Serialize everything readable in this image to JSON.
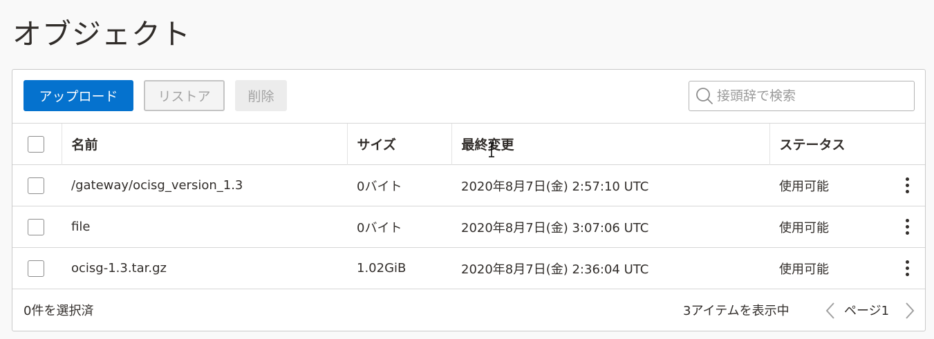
{
  "page": {
    "title": "オブジェクト"
  },
  "toolbar": {
    "upload_label": "アップロード",
    "restore_label": "リストア",
    "delete_label": "削除"
  },
  "search": {
    "placeholder": "接頭辞で検索",
    "value": "",
    "icon": "search-icon"
  },
  "table": {
    "headers": {
      "name": "名前",
      "size": "サイズ",
      "modified": "最終変更",
      "status": "ステータス"
    },
    "rows": [
      {
        "name": "/gateway/ocisg_version_1.3",
        "size": "0バイト",
        "modified": "2020年8月7日(金) 2:57:10 UTC",
        "status": "使用可能"
      },
      {
        "name": "file",
        "size": "0バイト",
        "modified": "2020年8月7日(金) 3:07:06 UTC",
        "status": "使用可能"
      },
      {
        "name": "ocisg-1.3.tar.gz",
        "size": "1.02GiB",
        "modified": "2020年8月7日(金) 2:36:04 UTC",
        "status": "使用可能"
      }
    ]
  },
  "footer": {
    "selected_text": "0件を選択済",
    "items_text": "3アイテムを表示中",
    "page_text": "ページ1"
  },
  "colors": {
    "primary": "#0572ce",
    "text": "#312d2a",
    "border": "#d6d6d6"
  }
}
